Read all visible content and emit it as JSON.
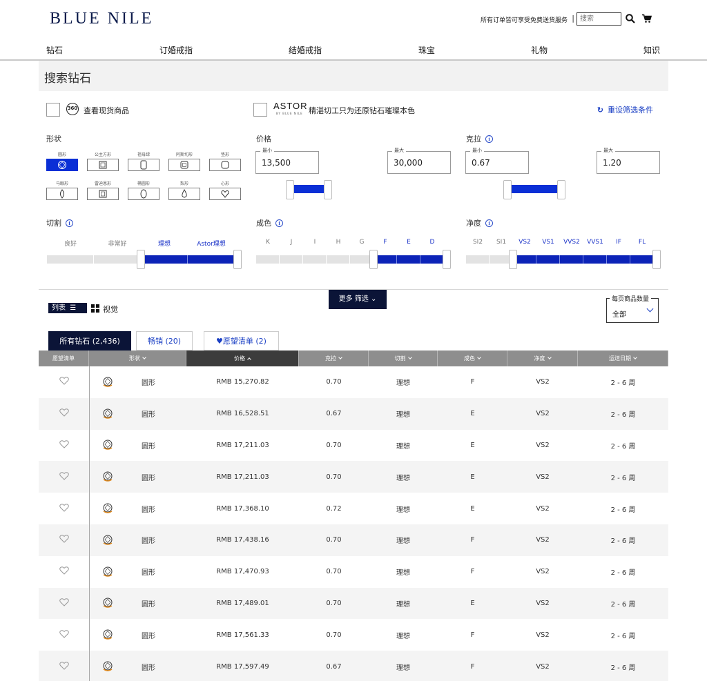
{
  "header": {
    "logo": "BLUE NILE",
    "free_shipping": "所有订单皆可享受免费送货服务",
    "separator": "|",
    "search_placeholder": "搜索"
  },
  "nav": [
    "钻石",
    "订婚戒指",
    "结婚戒指",
    "珠宝",
    "礼物",
    "知识"
  ],
  "page_title": "搜索钻石",
  "toggles": {
    "view_360_badge": "360",
    "view_360": "查看现货商品",
    "astor_logo": "ASTOR",
    "astor_sub": "BY BLUE NILE",
    "astor_text": "精湛切工只为还原钻石璀璨本色",
    "reset": "重设筛选条件"
  },
  "shape": {
    "label": "形状",
    "items": [
      {
        "name": "圆形",
        "selected": true
      },
      {
        "name": "公主方形",
        "selected": false
      },
      {
        "name": "祖母绿",
        "selected": false
      },
      {
        "name": "阿斯切形",
        "selected": false
      },
      {
        "name": "垫形",
        "selected": false
      },
      {
        "name": "马眼形",
        "selected": false
      },
      {
        "name": "雷迪恩形",
        "selected": false
      },
      {
        "name": "椭圆形",
        "selected": false
      },
      {
        "name": "梨形",
        "selected": false
      },
      {
        "name": "心形",
        "selected": false
      }
    ]
  },
  "price": {
    "label": "价格",
    "min_label": "最小",
    "max_label": "最大",
    "min": "13,500",
    "max": "30,000"
  },
  "carat": {
    "label": "克拉",
    "info": "i",
    "min_label": "最小",
    "max_label": "最大",
    "min": "0.67",
    "max": "1.20"
  },
  "cut": {
    "label": "切割",
    "info": "i",
    "grades": [
      "良好",
      "非常好",
      "理想",
      "Astor理想"
    ],
    "selected_from": 2
  },
  "color": {
    "label": "成色",
    "info": "i",
    "grades": [
      "K",
      "J",
      "I",
      "H",
      "G",
      "F",
      "E",
      "D"
    ],
    "selected_from": 5
  },
  "clarity": {
    "label": "净度",
    "info": "i",
    "grades": [
      "SI2",
      "SI1",
      "VS2",
      "VS1",
      "VVS2",
      "VVS1",
      "IF",
      "FL"
    ],
    "selected_from": 2
  },
  "more_filters": "更多 筛选",
  "view": {
    "list": "列表",
    "visual": "视觉"
  },
  "per_page": {
    "label": "每页商品数量",
    "value": "全部"
  },
  "tabs": [
    {
      "label": "所有钻石 (2,436)",
      "active": true
    },
    {
      "label": "畅销 (20)",
      "active": false
    },
    {
      "label": "愿望清单 (2)",
      "active": false
    }
  ],
  "table": {
    "columns": [
      "愿望清单",
      "形状",
      "价格",
      "克拉",
      "切割",
      "成色",
      "净度",
      "运送日期"
    ],
    "rows": [
      {
        "shape": "圆形",
        "price": "RMB 15,270.82",
        "carat": "0.70",
        "cut": "理想",
        "color": "F",
        "clarity": "VS2",
        "ship": "2 - 6 周"
      },
      {
        "shape": "圆形",
        "price": "RMB 16,528.51",
        "carat": "0.67",
        "cut": "理想",
        "color": "E",
        "clarity": "VS2",
        "ship": "2 - 6 周"
      },
      {
        "shape": "圆形",
        "price": "RMB 17,211.03",
        "carat": "0.70",
        "cut": "理想",
        "color": "E",
        "clarity": "VS2",
        "ship": "2 - 6 周"
      },
      {
        "shape": "圆形",
        "price": "RMB 17,211.03",
        "carat": "0.70",
        "cut": "理想",
        "color": "E",
        "clarity": "VS2",
        "ship": "2 - 6 周"
      },
      {
        "shape": "圆形",
        "price": "RMB 17,368.10",
        "carat": "0.72",
        "cut": "理想",
        "color": "E",
        "clarity": "VS2",
        "ship": "2 - 6 周"
      },
      {
        "shape": "圆形",
        "price": "RMB 17,438.16",
        "carat": "0.70",
        "cut": "理想",
        "color": "F",
        "clarity": "VS2",
        "ship": "2 - 6 周"
      },
      {
        "shape": "圆形",
        "price": "RMB 17,470.93",
        "carat": "0.70",
        "cut": "理想",
        "color": "F",
        "clarity": "VS2",
        "ship": "2 - 6 周"
      },
      {
        "shape": "圆形",
        "price": "RMB 17,489.01",
        "carat": "0.70",
        "cut": "理想",
        "color": "E",
        "clarity": "VS2",
        "ship": "2 - 6 周"
      },
      {
        "shape": "圆形",
        "price": "RMB 17,561.33",
        "carat": "0.70",
        "cut": "理想",
        "color": "F",
        "clarity": "VS2",
        "ship": "2 - 6 周"
      },
      {
        "shape": "圆形",
        "price": "RMB 17,597.49",
        "carat": "0.67",
        "cut": "理想",
        "color": "F",
        "clarity": "VS2",
        "ship": "2 - 6 周"
      }
    ]
  },
  "colors": {
    "accent": "#0a2fd6",
    "navy": "#0b1437",
    "link": "#1a3fc4"
  }
}
